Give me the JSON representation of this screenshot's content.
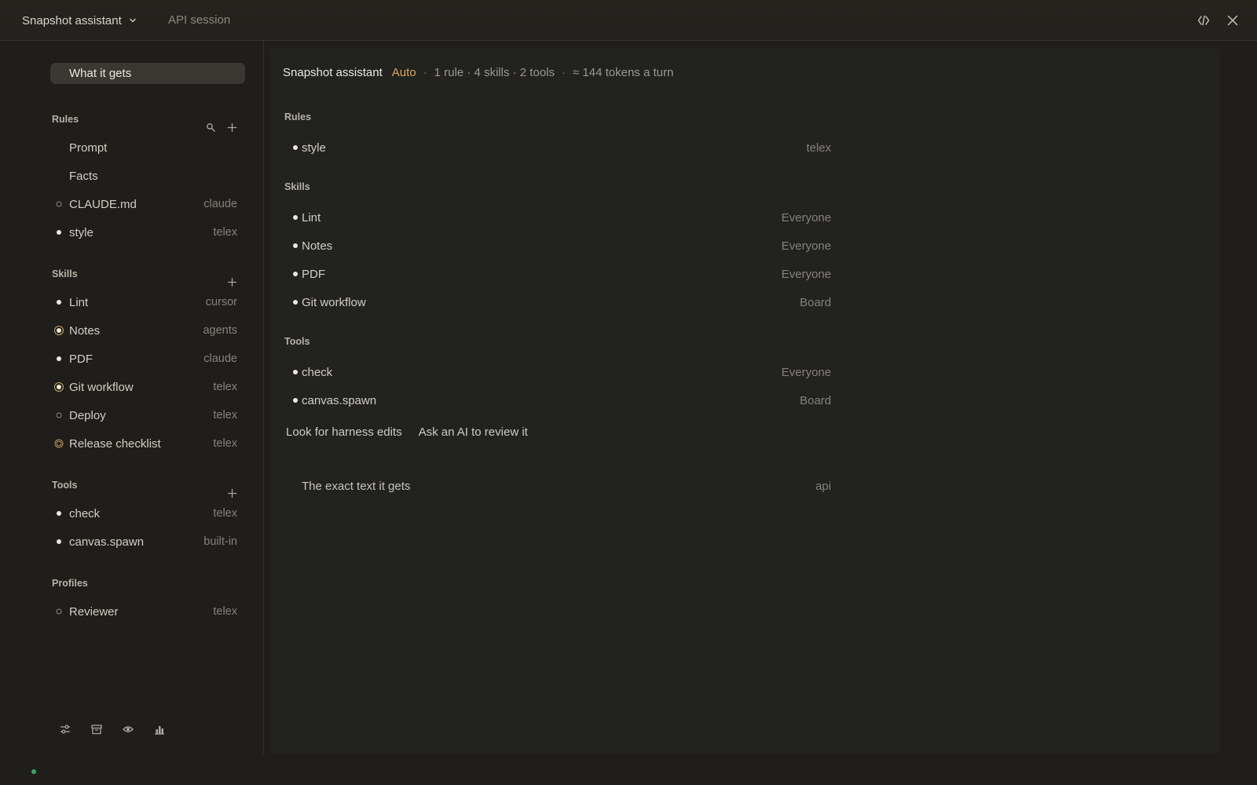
{
  "titlebar": {
    "app_name": "Snapshot assistant",
    "session_label": "API session",
    "icons": [
      "chevron-down-icon",
      "code-toggle-icon",
      "close-icon"
    ]
  },
  "sidebar": {
    "top_item": "What it gets",
    "rules": {
      "heading": "Rules",
      "items": [
        {
          "name": "Prompt",
          "source": "",
          "marker": "none"
        },
        {
          "name": "Facts",
          "source": "",
          "marker": "none"
        },
        {
          "name": "CLAUDE.md",
          "source": "claude",
          "marker": "hollow"
        },
        {
          "name": "style",
          "source": "telex",
          "marker": "filled"
        }
      ]
    },
    "skills": {
      "heading": "Skills",
      "items": [
        {
          "name": "Lint",
          "source": "cursor",
          "marker": "filled"
        },
        {
          "name": "Notes",
          "source": "agents",
          "marker": "target"
        },
        {
          "name": "PDF",
          "source": "claude",
          "marker": "filled"
        },
        {
          "name": "Git workflow",
          "source": "telex",
          "marker": "target"
        },
        {
          "name": "Deploy",
          "source": "telex",
          "marker": "hollow"
        },
        {
          "name": "Release checklist",
          "source": "telex",
          "marker": "ring"
        }
      ]
    },
    "tools": {
      "heading": "Tools",
      "items": [
        {
          "name": "check",
          "source": "telex",
          "marker": "filled"
        },
        {
          "name": "canvas.spawn",
          "source": "built-in",
          "marker": "filled"
        }
      ]
    },
    "profiles": {
      "heading": "Profiles",
      "items": [
        {
          "name": "Reviewer",
          "source": "telex",
          "marker": "hollow"
        }
      ]
    },
    "bottom_icons": [
      "sliders-icon",
      "archive-icon",
      "eye-icon",
      "chart-icon"
    ]
  },
  "main": {
    "summary": {
      "title": "Snapshot assistant",
      "mode": "Auto",
      "separator": "·",
      "counts": "1 rule · 4 skills · 2 tools",
      "tokens": "≈ 144 tokens a turn"
    },
    "rules": {
      "heading": "Rules",
      "items": [
        {
          "name": "style",
          "scope": "telex"
        }
      ]
    },
    "skills": {
      "heading": "Skills",
      "items": [
        {
          "name": "Lint",
          "scope": "Everyone"
        },
        {
          "name": "Notes",
          "scope": "Everyone"
        },
        {
          "name": "PDF",
          "scope": "Everyone"
        },
        {
          "name": "Git workflow",
          "scope": "Board"
        }
      ]
    },
    "tools": {
      "heading": "Tools",
      "items": [
        {
          "name": "check",
          "scope": "Everyone"
        },
        {
          "name": "canvas.spawn",
          "scope": "Board"
        }
      ]
    },
    "actions": {
      "look_for_edits": "Look for harness edits",
      "ask_ai": "Ask an AI to review it"
    },
    "exact_text": {
      "label": "The exact text it gets",
      "source": "api"
    }
  },
  "colors": {
    "background": "#1f1e1b",
    "panel": "#22221f",
    "accent_auto": "#d9a85a",
    "status_ok": "#3fa36b"
  }
}
